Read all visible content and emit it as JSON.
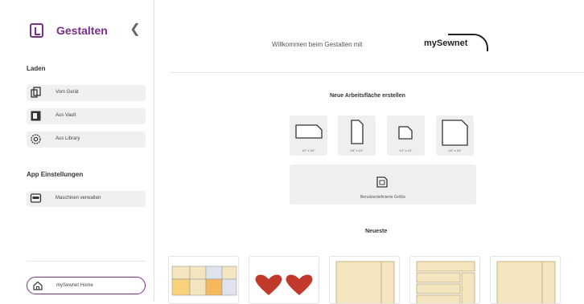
{
  "sidebar": {
    "title": "Gestalten",
    "sections": [
      {
        "label": "Laden",
        "items": [
          {
            "label": "Vom Gerät",
            "icon": "device-icon"
          },
          {
            "label": "Aus Vault",
            "icon": "vault-icon"
          },
          {
            "label": "Aus Library",
            "icon": "library-icon"
          }
        ]
      },
      {
        "label": "App Einstellungen",
        "items": [
          {
            "label": "Maschinen verwalten",
            "icon": "sewing-machine-icon"
          }
        ]
      }
    ],
    "home_button": {
      "label": "mySewnet Home",
      "icon": "home-icon"
    }
  },
  "main": {
    "welcome": "Willkommen beim Gestalten mit",
    "brand": "mySewnet",
    "new_workspace_title": "Neue Arbeitsfläche erstellen",
    "sizes": [
      {
        "label": "12\" x 24\"",
        "shape": "landscape"
      },
      {
        "label": "24\" x 12\"",
        "shape": "portrait"
      },
      {
        "label": "12\" x 12\"",
        "shape": "square-small"
      },
      {
        "label": "24\" x 24\"",
        "shape": "square-large"
      }
    ],
    "custom_size": {
      "label": "Benutzerdefinierte Größe",
      "icon": "custom-size-icon"
    },
    "recent_title": "Neueste"
  },
  "colors": {
    "accent": "#7a2e8c",
    "tile_bg": "#efefef",
    "thumb_tan": "#f3e6bf",
    "heart_red": "#c0392b"
  }
}
